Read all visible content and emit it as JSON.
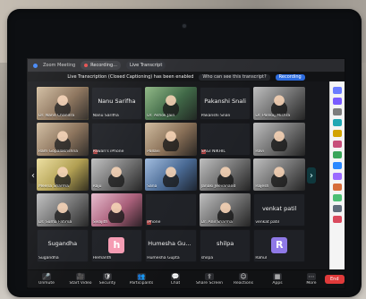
{
  "app": {
    "window_title": "Zoom Meeting",
    "recording_label": "Recording...",
    "live_transcription_label": "Live Transcript",
    "notice_text": "Live Transcription (Closed Captioning) has been enabled",
    "notice_question": "Who can see this transcript?",
    "notice_action": "Recording"
  },
  "toolbar": {
    "items": [
      {
        "label": "Unmute",
        "icon": "mic-icon"
      },
      {
        "label": "Start Video",
        "icon": "video-icon"
      },
      {
        "label": "Security",
        "icon": "shield-icon"
      },
      {
        "label": "Participants",
        "icon": "participants-icon"
      },
      {
        "label": "Chat",
        "icon": "chat-icon"
      },
      {
        "label": "Share Screen",
        "icon": "share-icon"
      },
      {
        "label": "Reactions",
        "icon": "reactions-icon"
      },
      {
        "label": "Apps",
        "icon": "apps-icon"
      },
      {
        "label": "More",
        "icon": "more-icon"
      }
    ],
    "end_label": "End"
  },
  "participants": [
    {
      "name": "Dr. Nand Chandra",
      "type": "video",
      "tone": "warm",
      "active": true
    },
    {
      "name": "Nanu Sarifha",
      "type": "name",
      "tone": "gray",
      "active": false,
      "center_label": "Nanu Sarifha"
    },
    {
      "name": "Dr. Ashok Jain",
      "type": "video",
      "tone": "green",
      "active": false
    },
    {
      "name": "Pakanshi Snali",
      "type": "name",
      "tone": "gray",
      "active": false,
      "center_label": "Pakanshi Snali"
    },
    {
      "name": "Dr. Pankaj Mishra",
      "type": "video",
      "tone": "gray",
      "active": false
    },
    {
      "name": "Ram Gopalakrishna",
      "type": "video",
      "tone": "warm",
      "active": false
    },
    {
      "name": "Pawan's iPhone",
      "type": "name",
      "tone": "gray",
      "active": false,
      "center_label": ""
    },
    {
      "name": "Pallavi",
      "type": "video",
      "tone": "warm",
      "active": false
    },
    {
      "name": "SAGI NIKHIL",
      "type": "name",
      "tone": "gray",
      "active": false,
      "center_label": ""
    },
    {
      "name": "Ravi",
      "type": "video",
      "tone": "gray",
      "active": false
    },
    {
      "name": "Meena Sharma",
      "type": "video",
      "tone": "yellow",
      "active": false
    },
    {
      "name": "Raju",
      "type": "video",
      "tone": "gray",
      "active": false
    },
    {
      "name": "Sana",
      "type": "video",
      "tone": "blue",
      "active": false
    },
    {
      "name": "Janaki Jeevanand",
      "type": "video",
      "tone": "gray",
      "active": false
    },
    {
      "name": "Rajesh",
      "type": "video",
      "tone": "gray",
      "active": false
    },
    {
      "name": "Dr. Suma Fatima",
      "type": "video",
      "tone": "gray",
      "active": false
    },
    {
      "name": "Sivajith",
      "type": "video",
      "tone": "pink",
      "active": false
    },
    {
      "name": "iPhone",
      "type": "name",
      "tone": "gray",
      "active": false,
      "center_label": ""
    },
    {
      "name": "Dr. Anil Sharma",
      "type": "video",
      "tone": "gray",
      "active": false
    },
    {
      "name": "venkat patil",
      "type": "name",
      "tone": "gray",
      "active": false,
      "center_label": "venkat patil"
    },
    {
      "name": "Sugandha",
      "type": "name",
      "tone": "gray",
      "active": false,
      "center_label": "Sugandha"
    },
    {
      "name": "Hemanth",
      "type": "avatar",
      "tone": "pink",
      "avatar_text": "h",
      "active": false
    },
    {
      "name": "Humesha Gupta",
      "type": "name",
      "tone": "gray",
      "active": false,
      "center_label": "Humesha Gupta"
    },
    {
      "name": "shilpa",
      "type": "name",
      "tone": "gray",
      "active": false,
      "center_label": "shilpa"
    },
    {
      "name": "Rahul",
      "type": "avatar",
      "tone": "purple",
      "avatar_text": "R",
      "active": false
    }
  ],
  "right_rail_colors": [
    "#6b7cff",
    "#7a5cff",
    "#7c7c7c",
    "#20a7b3",
    "#d2a300",
    "#c74f7a",
    "#3aa55a",
    "#2b88ff",
    "#9c6bff",
    "#d66c3a",
    "#4cbf74",
    "#5f6b7a",
    "#d9495d"
  ]
}
